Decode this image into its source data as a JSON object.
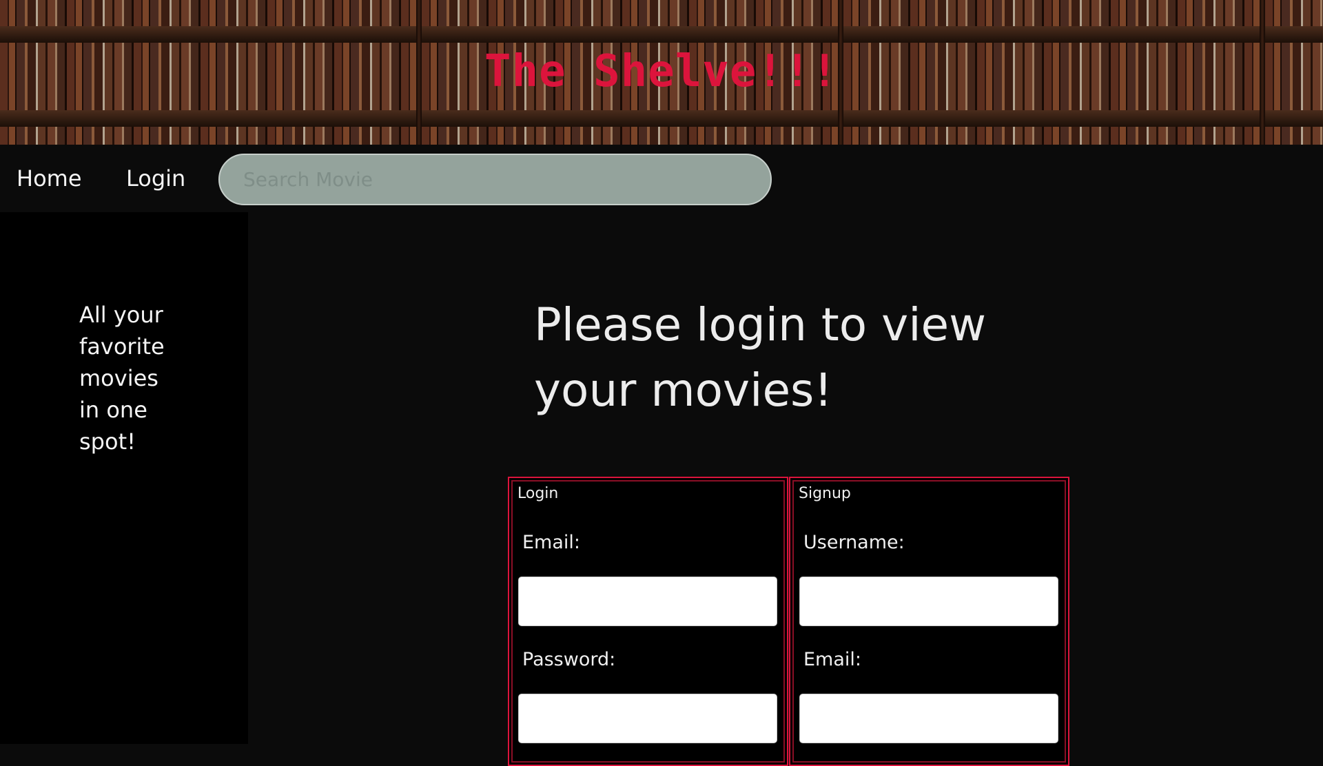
{
  "header": {
    "title": "The Shelve!!!"
  },
  "nav": {
    "home_label": "Home",
    "login_label": "Login",
    "search_placeholder": "Search Movie",
    "search_value": ""
  },
  "sidebar": {
    "tagline": "All your favorite movies in one spot!"
  },
  "main": {
    "heading": "Please login to view your movies!"
  },
  "login_form": {
    "legend": "Login",
    "email_label": "Email:",
    "email_value": "",
    "password_label": "Password:",
    "password_value": ""
  },
  "signup_form": {
    "legend": "Signup",
    "username_label": "Username:",
    "username_value": "",
    "email_label": "Email:",
    "email_value": ""
  },
  "colors": {
    "accent": "#dc143c",
    "background": "#0b0b0b",
    "sidebar": "#000000",
    "search_fill": "#94a39c"
  }
}
